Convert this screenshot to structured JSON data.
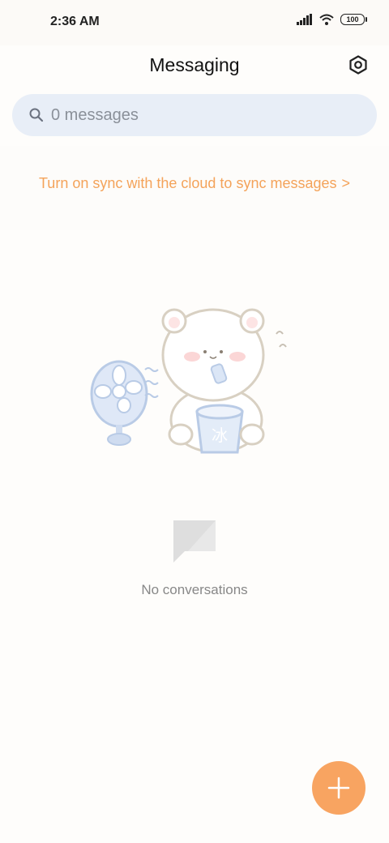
{
  "status_bar": {
    "time": "2:36 AM",
    "battery": "100",
    "icons": [
      "signal-icon",
      "wifi-icon",
      "battery-icon"
    ]
  },
  "header": {
    "title": "Messaging",
    "settings_icon": "gear-icon"
  },
  "search": {
    "placeholder": "0 messages",
    "icon": "search-icon"
  },
  "sync": {
    "label": "Turn on sync with the cloud to sync messages",
    "chevron": ">"
  },
  "empty_state": {
    "illustration": "bear-with-fan-illustration",
    "icon": "chat-bubble-icon",
    "text": "No conversations"
  },
  "fab": {
    "icon": "plus-icon"
  },
  "colors": {
    "accent": "#f4a35a",
    "fab": "#f8a461",
    "search_bg": "#e8eef7",
    "background": "#fefdfb"
  }
}
